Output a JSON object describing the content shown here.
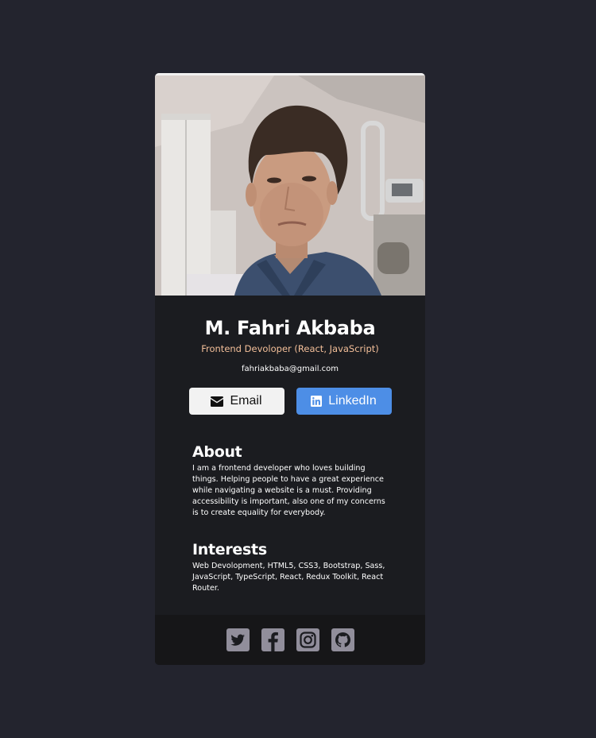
{
  "profile": {
    "name": "M. Fahri Akbaba",
    "role": "Frontend Devoloper (React, JavaScript)",
    "email": "fahriakbaba@gmail.com"
  },
  "buttons": {
    "email_label": "Email",
    "linkedin_label": "LinkedIn"
  },
  "about": {
    "heading": "About",
    "text": "I am a frontend developer who loves building things. Helping people to have a great experience while navigating a website is a must. Providing accessibility is important, also one of my concerns is to create equality for everybody."
  },
  "interests": {
    "heading": "Interests",
    "text": "Web Devolopment, HTML5, CSS3, Bootstrap, Sass, JavaScript, TypeScript, React, Redux Toolkit, React Router."
  },
  "social": {
    "icons": [
      "twitter-icon",
      "facebook-icon",
      "instagram-icon",
      "github-icon"
    ]
  },
  "colors": {
    "page_background": "#23242e",
    "card_background": "#1b1c20",
    "footer_background": "#161618",
    "role_text": "#f3bf99",
    "linkedin_blue": "#4d8ee6",
    "social_icon": "#918e9b"
  }
}
